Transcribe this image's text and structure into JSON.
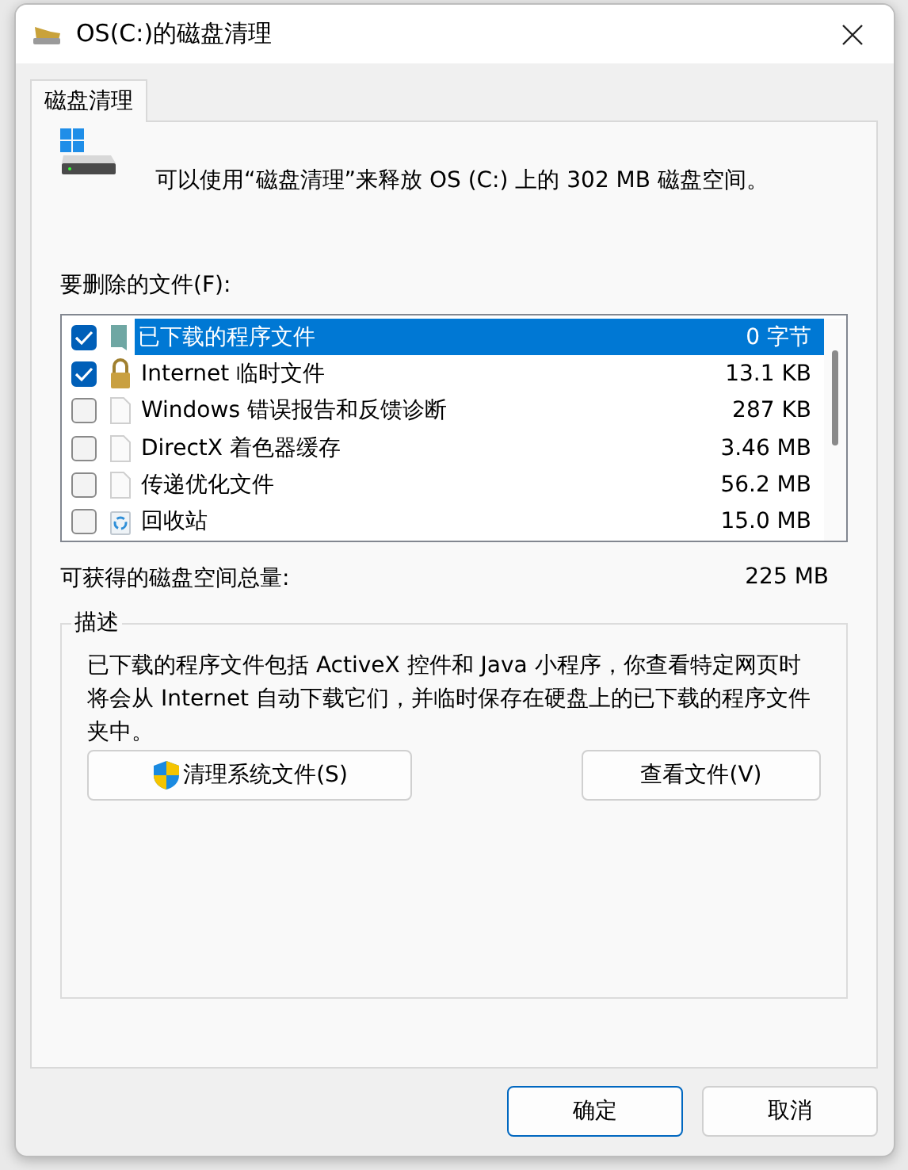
{
  "window": {
    "title": "OS(C:)的磁盘清理"
  },
  "tabs": [
    {
      "label": "磁盘清理",
      "selected": true
    }
  ],
  "summary": "可以使用“磁盘清理”来释放 OS (C:) 上的 302 MB 磁盘空间。",
  "files_label": "要删除的文件(F):",
  "files": [
    {
      "name": "已下载的程序文件",
      "size": "0 字节",
      "checked": true,
      "selected": true,
      "kind": "folder"
    },
    {
      "name": "Internet 临时文件",
      "size": "13.1 KB",
      "checked": true,
      "selected": false,
      "kind": "lock"
    },
    {
      "name": "Windows 错误报告和反馈诊断",
      "size": "287 KB",
      "checked": false,
      "selected": false,
      "kind": "file"
    },
    {
      "name": "DirectX 着色器缓存",
      "size": "3.46 MB",
      "checked": false,
      "selected": false,
      "kind": "file"
    },
    {
      "name": "传递优化文件",
      "size": "56.2 MB",
      "checked": false,
      "selected": false,
      "kind": "file"
    },
    {
      "name": "回收站",
      "size": "15.0 MB",
      "checked": false,
      "selected": false,
      "kind": "recycle"
    }
  ],
  "total": {
    "label": "可获得的磁盘空间总量:",
    "value": "225 MB"
  },
  "description": {
    "title": "描述",
    "text": "已下载的程序文件包括 ActiveX 控件和 Java 小程序，你查看特定网页时将会从 Internet 自动下载它们，并临时保存在硬盘上的已下载的程序文件夹中。"
  },
  "actions": [
    {
      "label": "清理系统文件(S)",
      "kind": "shield"
    },
    {
      "label": "查看文件(V)",
      "kind": "plain"
    }
  ],
  "buttons": [
    {
      "label": "确定",
      "default": true
    },
    {
      "label": "取消",
      "default": false
    }
  ]
}
